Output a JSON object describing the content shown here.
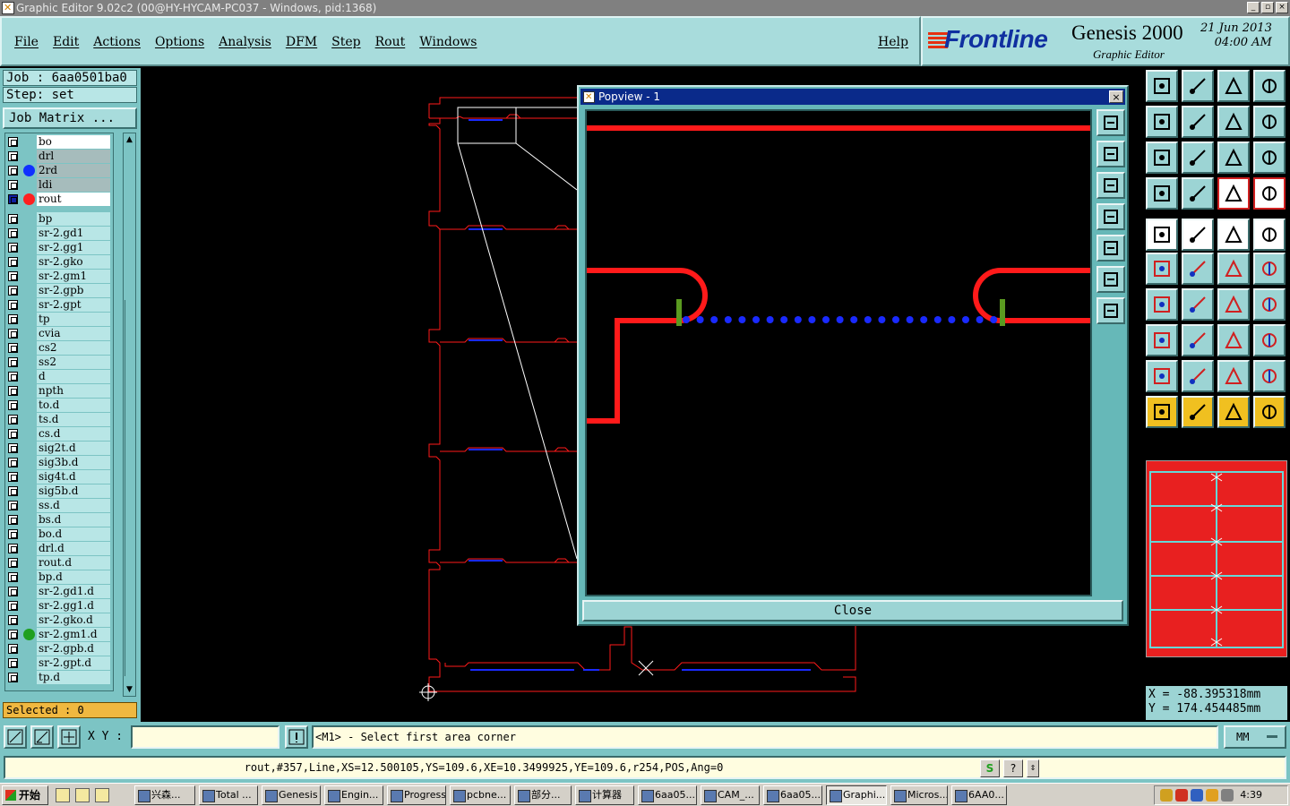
{
  "window": {
    "title": "Graphic Editor 9.02c2 (00@HY-HYCAM-PC037 - Windows, pid:1368)"
  },
  "menu": {
    "items": [
      "File",
      "Edit",
      "Actions",
      "Options",
      "Analysis",
      "DFM",
      "Step",
      "Rout",
      "Windows"
    ],
    "help": "Help"
  },
  "brand": {
    "logo": "Frontline",
    "product": "Genesis 2000",
    "subtitle": "Graphic Editor",
    "date": "21 Jun 2013",
    "time": "04:00 AM"
  },
  "job": {
    "job_line": "Job : 6aa0501ba0",
    "step_line": "Step: set",
    "matrix_button": "Job Matrix ..."
  },
  "layers": [
    {
      "name": "bo",
      "dot": "",
      "style": "sel"
    },
    {
      "name": "drl",
      "dot": "",
      "style": "gray"
    },
    {
      "name": "2rd",
      "dot": "#1030ff",
      "style": "gray"
    },
    {
      "name": "ldi",
      "dot": "",
      "style": "gray"
    },
    {
      "name": "rout",
      "dot": "#ff2020",
      "style": "sel",
      "active": true
    },
    {
      "name": "bp",
      "dot": "",
      "style": ""
    },
    {
      "name": "sr-2.gd1",
      "dot": "",
      "style": ""
    },
    {
      "name": "sr-2.gg1",
      "dot": "",
      "style": ""
    },
    {
      "name": "sr-2.gko",
      "dot": "",
      "style": ""
    },
    {
      "name": "sr-2.gm1",
      "dot": "",
      "style": ""
    },
    {
      "name": "sr-2.gpb",
      "dot": "",
      "style": ""
    },
    {
      "name": "sr-2.gpt",
      "dot": "",
      "style": ""
    },
    {
      "name": "tp",
      "dot": "",
      "style": ""
    },
    {
      "name": "cvia",
      "dot": "",
      "style": ""
    },
    {
      "name": "cs2",
      "dot": "",
      "style": ""
    },
    {
      "name": "ss2",
      "dot": "",
      "style": ""
    },
    {
      "name": "d",
      "dot": "",
      "style": ""
    },
    {
      "name": "npth",
      "dot": "",
      "style": ""
    },
    {
      "name": "to.d",
      "dot": "",
      "style": ""
    },
    {
      "name": "ts.d",
      "dot": "",
      "style": ""
    },
    {
      "name": "cs.d",
      "dot": "",
      "style": ""
    },
    {
      "name": "sig2t.d",
      "dot": "",
      "style": ""
    },
    {
      "name": "sig3b.d",
      "dot": "",
      "style": ""
    },
    {
      "name": "sig4t.d",
      "dot": "",
      "style": ""
    },
    {
      "name": "sig5b.d",
      "dot": "",
      "style": ""
    },
    {
      "name": "ss.d",
      "dot": "",
      "style": ""
    },
    {
      "name": "bs.d",
      "dot": "",
      "style": ""
    },
    {
      "name": "bo.d",
      "dot": "",
      "style": ""
    },
    {
      "name": "drl.d",
      "dot": "",
      "style": ""
    },
    {
      "name": "rout.d",
      "dot": "",
      "style": ""
    },
    {
      "name": "bp.d",
      "dot": "",
      "style": ""
    },
    {
      "name": "sr-2.gd1.d",
      "dot": "",
      "style": ""
    },
    {
      "name": "sr-2.gg1.d",
      "dot": "",
      "style": ""
    },
    {
      "name": "sr-2.gko.d",
      "dot": "",
      "style": ""
    },
    {
      "name": "sr-2.gm1.d",
      "dot": "#20a020",
      "style": ""
    },
    {
      "name": "sr-2.gpb.d",
      "dot": "",
      "style": ""
    },
    {
      "name": "sr-2.gpt.d",
      "dot": "",
      "style": ""
    },
    {
      "name": "tp.d",
      "dot": "",
      "style": ""
    }
  ],
  "selected": "Selected : 0",
  "popview": {
    "title": "Popview - 1",
    "close_label": "Close"
  },
  "coords": {
    "x_line": "X = -88.395318mm",
    "y_line": "Y = 174.454485mm"
  },
  "command": {
    "xy_label": "X Y :",
    "xy_value": "",
    "prompt": "<M1> - Select first area corner",
    "units": "MM"
  },
  "status": {
    "text": "rout,#357,Line,XS=12.500105,YS=109.6,XE=10.3499925,YE=109.6,r254,POS,Ang=0"
  },
  "taskbar": {
    "start": "开始",
    "tasks": [
      "兴森...",
      "Total ...",
      "Genesis",
      "Engin...",
      "Progress",
      "pcbne...",
      "部分...",
      "计算器",
      "6aa05...",
      "CAM_...",
      "6aa05...",
      "Graphi...",
      "Micros...",
      "6AA0..."
    ],
    "active_index": 11,
    "clock": "4:39"
  },
  "colors": {
    "rout": "#ff1a1a",
    "drill_dot": "#1a2aff",
    "panel": "#7cc4c4",
    "menubar": "#a8dcdc"
  }
}
